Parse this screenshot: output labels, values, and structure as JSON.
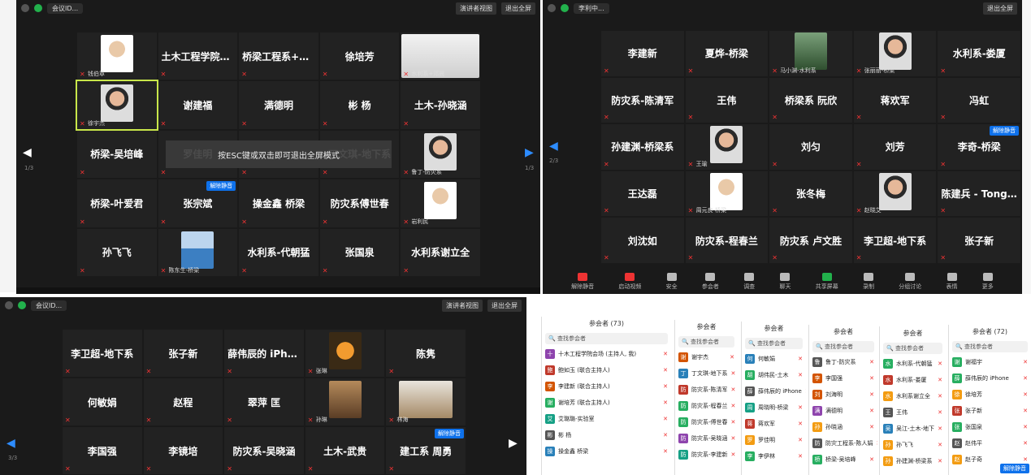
{
  "colors": {
    "mute": "#ee3333",
    "host_badge": "#0e71eb",
    "end": "#e02828",
    "share": "#22b14c"
  },
  "pane_a": {
    "meeting": "会议ID...",
    "view_btn": "演讲者视图",
    "exit_fs": "退出全屏",
    "page": "1/3",
    "page_r": "1/3",
    "banner": "按ESC键或双击即可退出全屏模式",
    "tiles": [
      {
        "label": "",
        "name": "钱伯章",
        "photo": "face"
      },
      {
        "label": "土木工程学院会场",
        "name": ""
      },
      {
        "label": "桥梁工程系+彭...",
        "name": ""
      },
      {
        "label": "徐培芳",
        "name": ""
      },
      {
        "label": "",
        "name": "水利系+邓晨",
        "photo": "self"
      },
      {
        "label": "",
        "name": "徐宇杰",
        "photo": "face2",
        "active": true
      },
      {
        "label": "谢建福",
        "name": ""
      },
      {
        "label": "满德明",
        "name": ""
      },
      {
        "label": "彬 杨",
        "name": ""
      },
      {
        "label": "土木-孙晓涵",
        "name": ""
      },
      {
        "label": "桥梁-吴培峰",
        "name": ""
      },
      {
        "label": "罗佳明",
        "name": ""
      },
      {
        "label": "",
        "name": ""
      },
      {
        "label": "丁文琪-地下系",
        "name": ""
      },
      {
        "label": "",
        "name": "鲁丁-防灾系",
        "photo": "face2"
      },
      {
        "label": "桥梁-叶爱君",
        "name": ""
      },
      {
        "label": "张宗斌",
        "name": "",
        "host": "解除静音"
      },
      {
        "label": "操金鑫 桥梁",
        "name": ""
      },
      {
        "label": "防灾系傅世春",
        "name": ""
      },
      {
        "label": "",
        "name": "岩利民",
        "photo": "face"
      },
      {
        "label": "孙飞飞",
        "name": ""
      },
      {
        "label": "",
        "name": "陈东生-桥梁",
        "photo": "pier"
      },
      {
        "label": "水利系-代朝猛",
        "name": ""
      },
      {
        "label": "张国泉",
        "name": ""
      },
      {
        "label": "水利系谢立全",
        "name": ""
      }
    ]
  },
  "pane_b": {
    "meeting": "李利中...",
    "exit_fs": "退出全屏",
    "page": "2/3",
    "host_badge": "解除静音",
    "tiles": [
      {
        "label": "李建新",
        "name": ""
      },
      {
        "label": "夏烨-桥梁",
        "name": ""
      },
      {
        "label": "",
        "name": "马小渊-水利系",
        "photo": "nature"
      },
      {
        "label": "",
        "name": "张丽丽-桥梁",
        "photo": "face2"
      },
      {
        "label": "水利系-娄厦",
        "name": ""
      },
      {
        "label": "防灾系-陈清军",
        "name": ""
      },
      {
        "label": "王伟",
        "name": ""
      },
      {
        "label": "桥梁系 阮欣",
        "name": ""
      },
      {
        "label": "蒋欢军",
        "name": ""
      },
      {
        "label": "冯虹",
        "name": ""
      },
      {
        "label": "孙建渊-桥梁系",
        "name": ""
      },
      {
        "label": "",
        "name": "王瑜",
        "photo": "face2"
      },
      {
        "label": "刘匀",
        "name": ""
      },
      {
        "label": "刘芳",
        "name": ""
      },
      {
        "label": "李奇-桥梁",
        "name": "",
        "host": "解除静音"
      },
      {
        "label": "王达磊",
        "name": ""
      },
      {
        "label": "",
        "name": "周元良-桥梁",
        "photo": "face"
      },
      {
        "label": "张冬梅",
        "name": ""
      },
      {
        "label": "",
        "name": "赵晓艾",
        "photo": "face2"
      },
      {
        "label": "陈建兵 - Tongji...",
        "name": ""
      },
      {
        "label": "刘沈如",
        "name": ""
      },
      {
        "label": "防灾系-程春兰",
        "name": ""
      },
      {
        "label": "防灾系 卢文胜",
        "name": ""
      },
      {
        "label": "李卫超-地下系",
        "name": ""
      },
      {
        "label": "张子新",
        "name": ""
      }
    ],
    "toolbar": [
      "解除静音",
      "启动视频",
      "安全",
      "参会者",
      "调查",
      "聊天",
      "共享屏幕",
      "录制",
      "分组讨论",
      "表情",
      "更多"
    ]
  },
  "pane_c": {
    "meeting": "会议ID...",
    "view_btn": "演讲者视图",
    "exit_fs": "退出全屏",
    "page": "3/3",
    "host_badge": "解除静音",
    "tiles": [
      {
        "label": "李卫超-地下系",
        "name": ""
      },
      {
        "label": "张子新",
        "name": ""
      },
      {
        "label": "薛伟辰的 iPhone",
        "name": ""
      },
      {
        "label": "",
        "name": "张琳",
        "photo": "flower"
      },
      {
        "label": "陈隽",
        "name": ""
      },
      {
        "label": "何敏娟",
        "name": ""
      },
      {
        "label": "赵程",
        "name": ""
      },
      {
        "label": "翠萍 匡",
        "name": ""
      },
      {
        "label": "",
        "name": "孙琳",
        "photo": "leaves"
      },
      {
        "label": "",
        "name": "林海",
        "photo": "dogs"
      },
      {
        "label": "李国强",
        "name": ""
      },
      {
        "label": "李镜培",
        "name": ""
      },
      {
        "label": "防灾系-吴晓涵",
        "name": ""
      },
      {
        "label": "土木-武贵",
        "name": ""
      },
      {
        "label": "建工系 周勇",
        "name": "",
        "host": "解除静音"
      }
    ]
  },
  "participants": {
    "p1": {
      "title": "参会者 (73)",
      "search": "查找参会者",
      "rows": [
        {
          "name": "十木工程学院会场 (主持人, 我)",
          "c": "#8e44ad",
          "i": "十"
        },
        {
          "name": "鲍如玉 (联合主持人)",
          "c": "#c0392b",
          "i": "鲍"
        },
        {
          "name": "李建新 (联合主持人)",
          "c": "#d35400",
          "i": "李"
        },
        {
          "name": "谢培芳 (联合主持人)",
          "c": "#27ae60",
          "i": "谢"
        },
        {
          "name": "艾璐璐-实验室",
          "c": "#16a085",
          "i": "艾"
        },
        {
          "name": "彬 杨",
          "c": "#555555",
          "i": "彬"
        },
        {
          "name": "操金鑫 桥梁",
          "c": "#2980b9",
          "i": "操"
        }
      ]
    },
    "p2": {
      "title": "参会者",
      "search": "查找参会者",
      "rows": [
        {
          "name": "谢宇杰",
          "c": "#d35400",
          "i": "谢"
        },
        {
          "name": "丁文琪-地下系",
          "c": "#2980b9",
          "i": "丁"
        },
        {
          "name": "防灾系-陈清军",
          "c": "#c0392b",
          "i": "防"
        },
        {
          "name": "防灾系-程春兰",
          "c": "#27ae60",
          "i": "防"
        },
        {
          "name": "防灾系-傅世春",
          "c": "#27ae60",
          "i": "防"
        },
        {
          "name": "防灾系-吴晓涵",
          "c": "#8e44ad",
          "i": "防"
        },
        {
          "name": "防灾系-李建新",
          "c": "#16a085",
          "i": "防"
        }
      ]
    },
    "p3": {
      "title": "参会者",
      "search": "查找参会者",
      "rows": [
        {
          "name": "何敏娟",
          "c": "#2980b9",
          "i": "何"
        },
        {
          "name": "胡伟民-土木",
          "c": "#27ae60",
          "i": "胡"
        },
        {
          "name": "薛伟辰的 iPhone",
          "c": "#555555",
          "i": "薛"
        },
        {
          "name": "周晓明-桥梁",
          "c": "#16a085",
          "i": "周"
        },
        {
          "name": "蒋欢军",
          "c": "#c0392b",
          "i": "蒋"
        },
        {
          "name": "罗佳明",
          "c": "#f39c12",
          "i": "罗"
        },
        {
          "name": "李伊林",
          "c": "#27ae60",
          "i": "李"
        }
      ]
    },
    "p4": {
      "title": "参会者",
      "search": "查找参会者",
      "rows": [
        {
          "name": "鲁丁-防灾系",
          "c": "#555555",
          "i": "鲁"
        },
        {
          "name": "李国强",
          "c": "#d35400",
          "i": "李"
        },
        {
          "name": "刘海明",
          "c": "#d35400",
          "i": "刘"
        },
        {
          "name": "满德明",
          "c": "#8e44ad",
          "i": "满"
        },
        {
          "name": "孙晓涵",
          "c": "#f39c12",
          "i": "孙"
        },
        {
          "name": "防灾工程系-陈人娟",
          "c": "#555555",
          "i": "防"
        },
        {
          "name": "桥梁-吴培峰",
          "c": "#27ae60",
          "i": "桥"
        }
      ]
    },
    "p5": {
      "title": "参会者",
      "search": "查找参会者",
      "rows": [
        {
          "name": "水利系-代朝猛",
          "c": "#27ae60",
          "i": "水"
        },
        {
          "name": "水利系-娄厦",
          "c": "#c0392b",
          "i": "水"
        },
        {
          "name": "水利系谢立全",
          "c": "#f39c12",
          "i": "水"
        },
        {
          "name": "王伟",
          "c": "#555555",
          "i": "王"
        },
        {
          "name": "吴江-土木-地下",
          "c": "#2980b9",
          "i": "吴"
        },
        {
          "name": "孙飞飞",
          "c": "#f39c12",
          "i": "孙"
        },
        {
          "name": "孙建渊-桥梁系",
          "c": "#f39c12",
          "i": "孙"
        }
      ]
    },
    "p6": {
      "title": "参会者 (72)",
      "search": "查找参会者",
      "rows": [
        {
          "name": "谢福宇",
          "c": "#27ae60",
          "i": "谢"
        },
        {
          "name": "薛伟辰的 iPhone",
          "c": "#27ae60",
          "i": "薛"
        },
        {
          "name": "徐培芳",
          "c": "#f39c12",
          "i": "徐"
        },
        {
          "name": "张子新",
          "c": "#c0392b",
          "i": "张"
        },
        {
          "name": "张国泉",
          "c": "#27ae60",
          "i": "张"
        },
        {
          "name": "赵伟平",
          "c": "#555555",
          "i": "赵"
        },
        {
          "name": "赵子奇",
          "c": "#f39c12",
          "i": "赵"
        }
      ],
      "host_badge": "解除静音"
    }
  }
}
